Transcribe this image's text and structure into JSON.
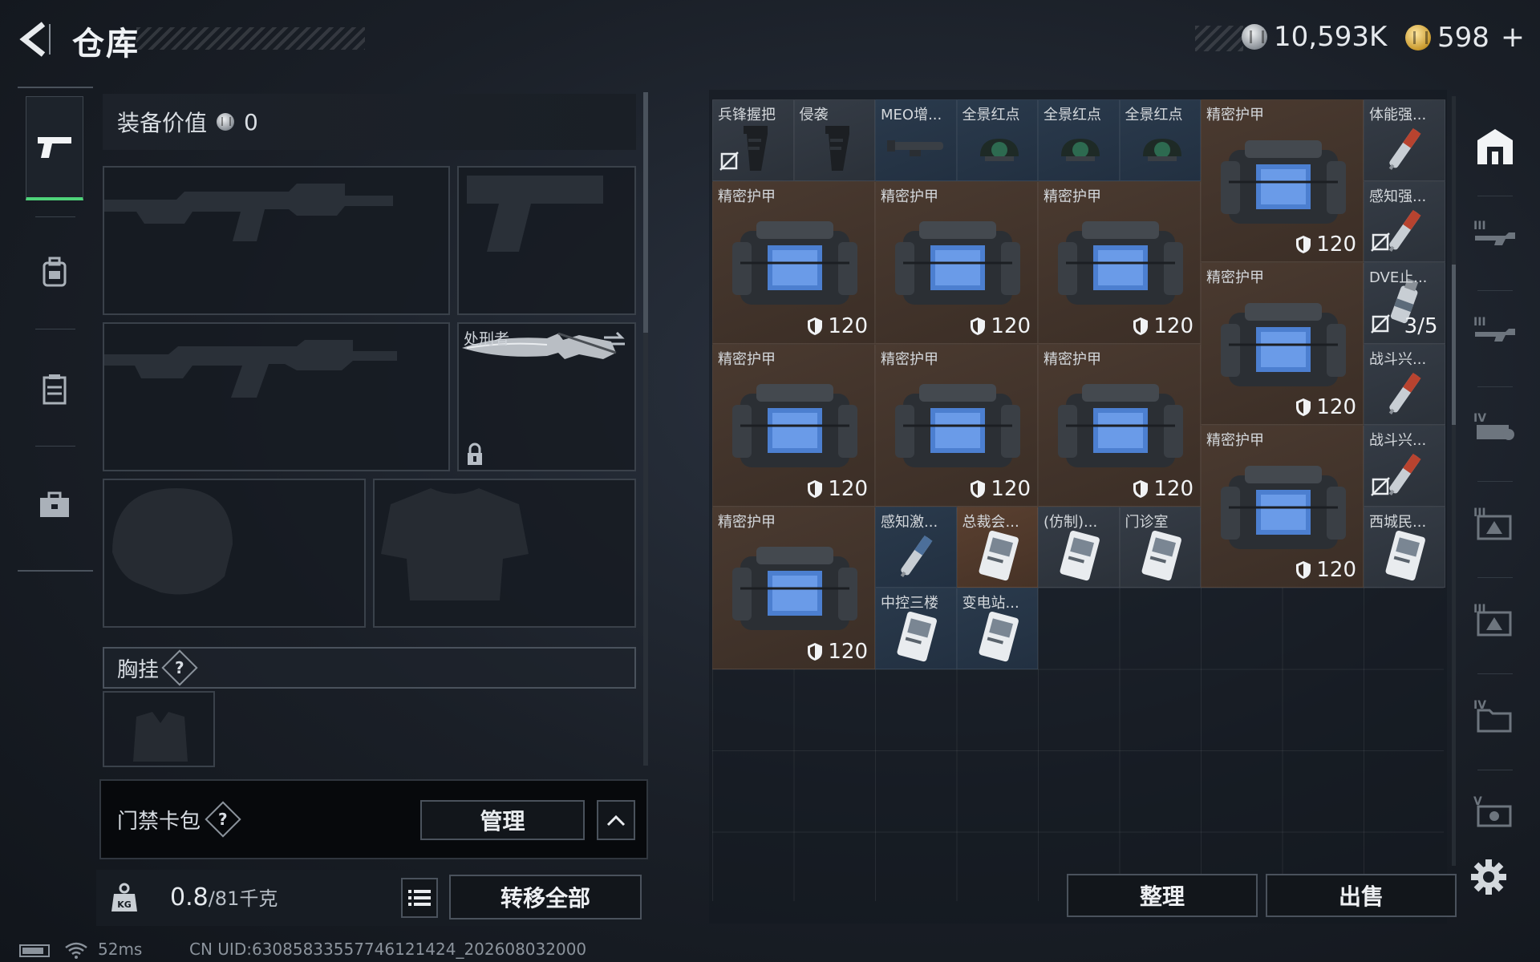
{
  "header": {
    "title": "仓库",
    "currencies": [
      {
        "name": "silver-coin",
        "amount": "10,593K"
      },
      {
        "name": "gold-coin",
        "amount": "598"
      }
    ],
    "add_label": "+"
  },
  "equipment": {
    "value_label": "装备价值",
    "value": "0",
    "melee_name": "处刑者",
    "chest_label": "胸挂",
    "chest_help": "?",
    "keycard_label": "门禁卡包",
    "keycard_help": "?",
    "manage_label": "管理",
    "weight_current": "0.8",
    "weight_max": "/81千克",
    "transfer_all_label": "转移全部"
  },
  "storage": {
    "items": [
      {
        "name": "兵锋握把",
        "kind": "grip",
        "color": "gray"
      },
      {
        "name": "侵袭",
        "kind": "grip",
        "color": "gray"
      },
      {
        "name": "MEO增...",
        "kind": "scope",
        "color": "blue"
      },
      {
        "name": "全景红点",
        "kind": "sight",
        "color": "blue"
      },
      {
        "name": "全景红点",
        "kind": "sight",
        "color": "blue"
      },
      {
        "name": "全景红点",
        "kind": "sight",
        "color": "blue"
      },
      {
        "name": "精密护甲",
        "kind": "armor",
        "color": "brown",
        "value": "120"
      },
      {
        "name": "体能强...",
        "kind": "injector",
        "color": "gray"
      },
      {
        "name": "精密护甲",
        "kind": "armor",
        "color": "brown",
        "value": "120"
      },
      {
        "name": "精密护甲",
        "kind": "armor",
        "color": "brown",
        "value": "120"
      },
      {
        "name": "精密护甲",
        "kind": "armor",
        "color": "brown",
        "value": "120"
      },
      {
        "name": "感知强...",
        "kind": "injector",
        "color": "gray"
      },
      {
        "name": "精密护甲",
        "kind": "armor",
        "color": "brown",
        "value": "120"
      },
      {
        "name": "DVE止...",
        "kind": "spray",
        "color": "gray",
        "value": "3/5"
      },
      {
        "name": "精密护甲",
        "kind": "armor",
        "color": "brown",
        "value": "120"
      },
      {
        "name": "精密护甲",
        "kind": "armor",
        "color": "brown",
        "value": "120"
      },
      {
        "name": "精密护甲",
        "kind": "armor",
        "color": "brown",
        "value": "120"
      },
      {
        "name": "战斗兴...",
        "kind": "injector",
        "color": "gray"
      },
      {
        "name": "精密护甲",
        "kind": "armor",
        "color": "brown",
        "value": "120"
      },
      {
        "name": "战斗兴...",
        "kind": "injector",
        "color": "gray"
      },
      {
        "name": "精密护甲",
        "kind": "armor",
        "color": "brown",
        "value": "120"
      },
      {
        "name": "感知激...",
        "kind": "injector",
        "color": "blue"
      },
      {
        "name": "总裁会...",
        "kind": "card",
        "color": "gold"
      },
      {
        "name": "(仿制)...",
        "kind": "card",
        "color": "gray"
      },
      {
        "name": "门诊室",
        "kind": "card",
        "color": "gray"
      },
      {
        "name": "西城民...",
        "kind": "card",
        "color": "gray"
      },
      {
        "name": "中控三楼",
        "kind": "card",
        "color": "blue"
      },
      {
        "name": "变电站...",
        "kind": "card",
        "color": "blue"
      }
    ],
    "sort_label": "整理",
    "sell_label": "出售"
  },
  "status": {
    "ping": "52ms",
    "uid": "CN UID:630858335577461214​24_202608032000"
  },
  "colors": {
    "accent_green": "#4fd37a",
    "armor_bg": "#4a3a30",
    "blue_bg": "#2a3a4c"
  }
}
